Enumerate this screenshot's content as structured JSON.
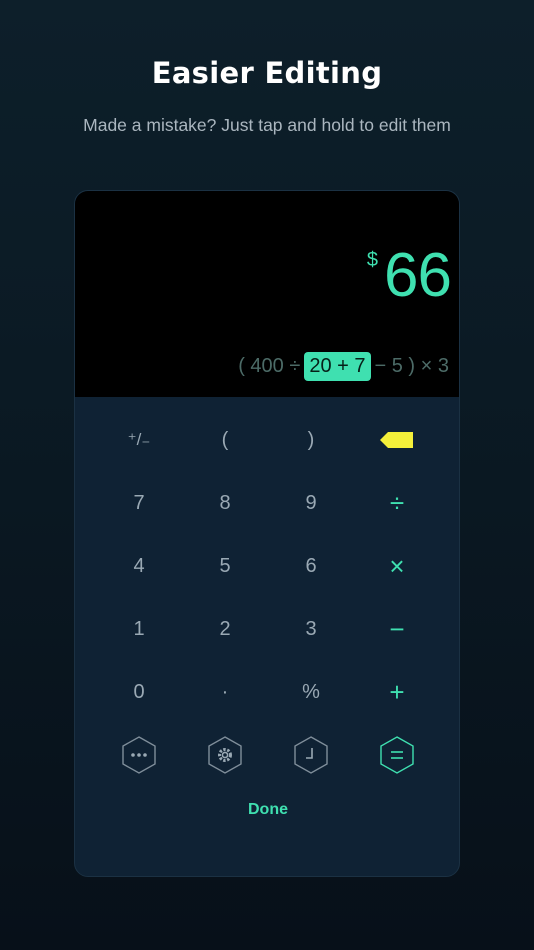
{
  "header": {
    "title": "Easier Editing",
    "subtitle": "Made a mistake? Just tap and hold to edit them"
  },
  "display": {
    "currency_symbol": "$",
    "result": "66",
    "expression": {
      "before": "( 400 ÷",
      "highlight": "20 + 7",
      "after": "− 5 ) × 3"
    }
  },
  "keypad": {
    "rows": [
      [
        "+/-",
        "(",
        ")",
        "backspace-icon"
      ],
      [
        "7",
        "8",
        "9",
        "÷"
      ],
      [
        "4",
        "5",
        "6",
        "×"
      ],
      [
        "1",
        "2",
        "3",
        "−"
      ],
      [
        "0",
        "·",
        "%",
        "+"
      ]
    ],
    "labels": {
      "plus_minus": "⁺/₋",
      "open_paren": "(",
      "close_paren": ")",
      "seven": "7",
      "eight": "8",
      "nine": "9",
      "divide": "÷",
      "four": "4",
      "five": "5",
      "six": "6",
      "multiply": "×",
      "one": "1",
      "two": "2",
      "three": "3",
      "minus": "−",
      "zero": "0",
      "decimal": "·",
      "percent": "%",
      "plus": "+"
    },
    "function_keys": [
      "more-icon",
      "gear-icon",
      "history-icon",
      "equals-icon"
    ],
    "done_label": "Done"
  },
  "colors": {
    "accent": "#3fe0b0",
    "backspace": "#f4f03a",
    "background": "#0d1f2a",
    "keypad_bg": "#0f2234",
    "display_bg": "#000000"
  }
}
